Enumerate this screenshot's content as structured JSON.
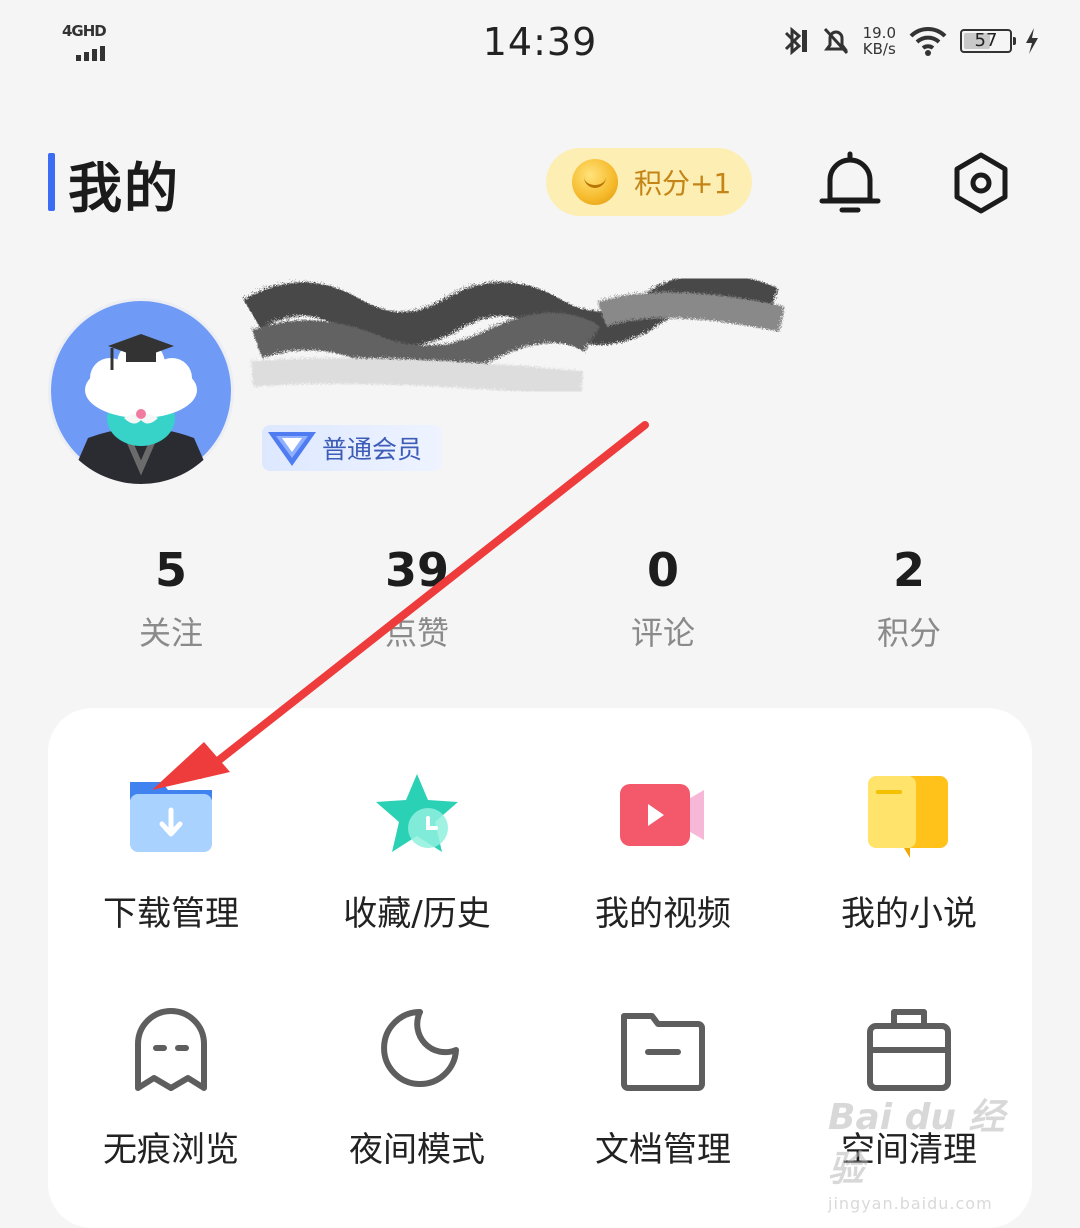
{
  "status_bar": {
    "network": "4GHD",
    "time": "14:39",
    "speed_value": "19.0",
    "speed_unit": "KB/s",
    "battery": "57"
  },
  "header": {
    "title": "我的",
    "points_button": "积分+1",
    "accent_color": "#3a6cf4"
  },
  "profile": {
    "member_badge": "普通会员"
  },
  "stats": [
    {
      "value": "5",
      "label": "关注"
    },
    {
      "value": "39",
      "label": "点赞"
    },
    {
      "value": "0",
      "label": "评论"
    },
    {
      "value": "2",
      "label": "积分"
    }
  ],
  "menu": [
    {
      "label": "下载管理",
      "icon": "download-folder-icon"
    },
    {
      "label": "收藏/历史",
      "icon": "star-clock-icon"
    },
    {
      "label": "我的视频",
      "icon": "video-camera-icon"
    },
    {
      "label": "我的小说",
      "icon": "book-icon"
    },
    {
      "label": "无痕浏览",
      "icon": "ghost-icon"
    },
    {
      "label": "夜间模式",
      "icon": "moon-icon"
    },
    {
      "label": "文档管理",
      "icon": "document-folder-icon"
    },
    {
      "label": "空间清理",
      "icon": "cleanup-bag-icon"
    }
  ],
  "watermark": {
    "text": "Bai du 经验",
    "sub": "jingyan.baidu.com"
  }
}
